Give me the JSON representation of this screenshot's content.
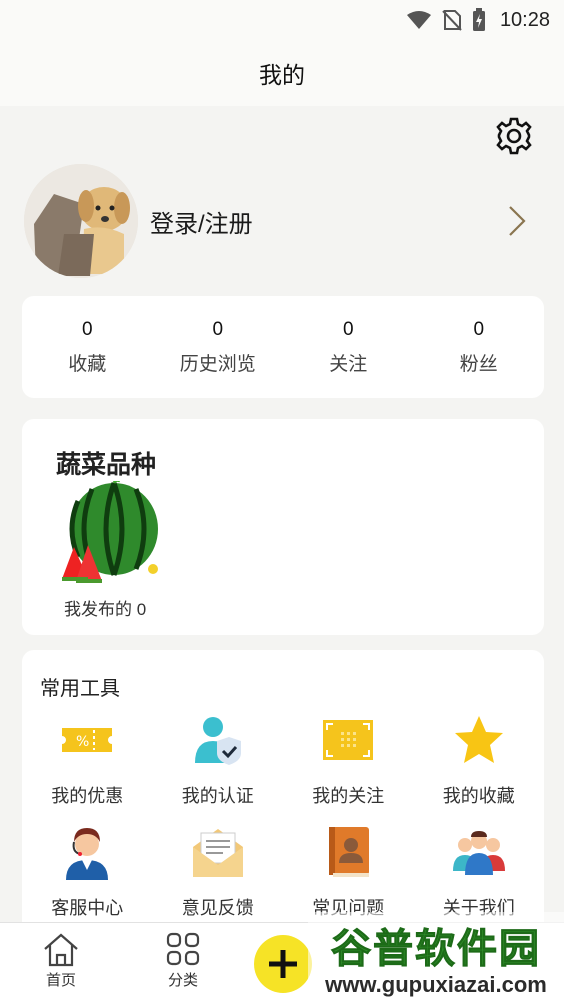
{
  "status_bar": {
    "time": "10:28",
    "icons": [
      "wifi-icon",
      "no-sim-icon",
      "battery-charging-icon"
    ]
  },
  "header": {
    "title": "我的"
  },
  "settings": {
    "icon": "gear-icon"
  },
  "profile": {
    "login_label": "登录/注册",
    "chevron_icon": "chevron-right-icon"
  },
  "stats": [
    {
      "value": "0",
      "label": "收藏"
    },
    {
      "value": "0",
      "label": "历史浏览"
    },
    {
      "value": "0",
      "label": "关注"
    },
    {
      "value": "0",
      "label": "粉丝"
    }
  ],
  "vegetable_card": {
    "title": "蔬菜品种",
    "image_icon": "watermelon-icon",
    "published_label": "我发布的 0"
  },
  "tools": {
    "title": "常用工具",
    "items": [
      {
        "label": "我的优惠",
        "icon": "coupon-icon"
      },
      {
        "label": "我的认证",
        "icon": "verified-user-icon"
      },
      {
        "label": "我的关注",
        "icon": "focus-frame-icon"
      },
      {
        "label": "我的收藏",
        "icon": "star-icon"
      },
      {
        "label": "客服中心",
        "icon": "customer-service-icon"
      },
      {
        "label": "意见反馈",
        "icon": "feedback-envelope-icon"
      },
      {
        "label": "常见问题",
        "icon": "faq-book-icon"
      },
      {
        "label": "关于我们",
        "icon": "team-icon"
      }
    ]
  },
  "tabbar": {
    "items": [
      {
        "label": "首页",
        "icon": "home-icon"
      },
      {
        "label": "分类",
        "icon": "grid-icon"
      }
    ],
    "add_icon": "plus-icon"
  },
  "watermark": {
    "title": "谷普软件园",
    "url": "www.gupuxiazai.com"
  },
  "colors": {
    "accent": "#f6e326",
    "background": "#f4f4f2",
    "card": "#ffffff"
  }
}
